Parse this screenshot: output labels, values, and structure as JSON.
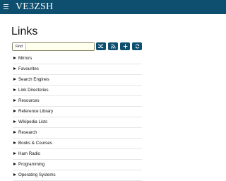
{
  "header": {
    "menu_icon": "hamburger-icon",
    "brand": "VE3ZSH",
    "bar_color": "#0e4f6f"
  },
  "page": {
    "title": "Links"
  },
  "search": {
    "label": "Find",
    "value": "",
    "placeholder": ""
  },
  "toolbar": {
    "buttons": [
      {
        "name": "shuffle",
        "icon": "shuffle-icon"
      },
      {
        "name": "rss",
        "icon": "rss-icon"
      },
      {
        "name": "add",
        "icon": "plus-icon"
      },
      {
        "name": "refresh",
        "icon": "refresh-icon"
      }
    ]
  },
  "links": {
    "items": [
      {
        "label": "Mirrors"
      },
      {
        "label": "Favourites"
      },
      {
        "label": "Search Engines"
      },
      {
        "label": "Link Directories"
      },
      {
        "label": "Resources"
      },
      {
        "label": "Reference Library"
      },
      {
        "label": "Wikipedia Lists"
      },
      {
        "label": "Research"
      },
      {
        "label": "Books & Courses"
      },
      {
        "label": "Ham Radio"
      },
      {
        "label": "Programming"
      },
      {
        "label": "Operating Systems"
      }
    ]
  }
}
